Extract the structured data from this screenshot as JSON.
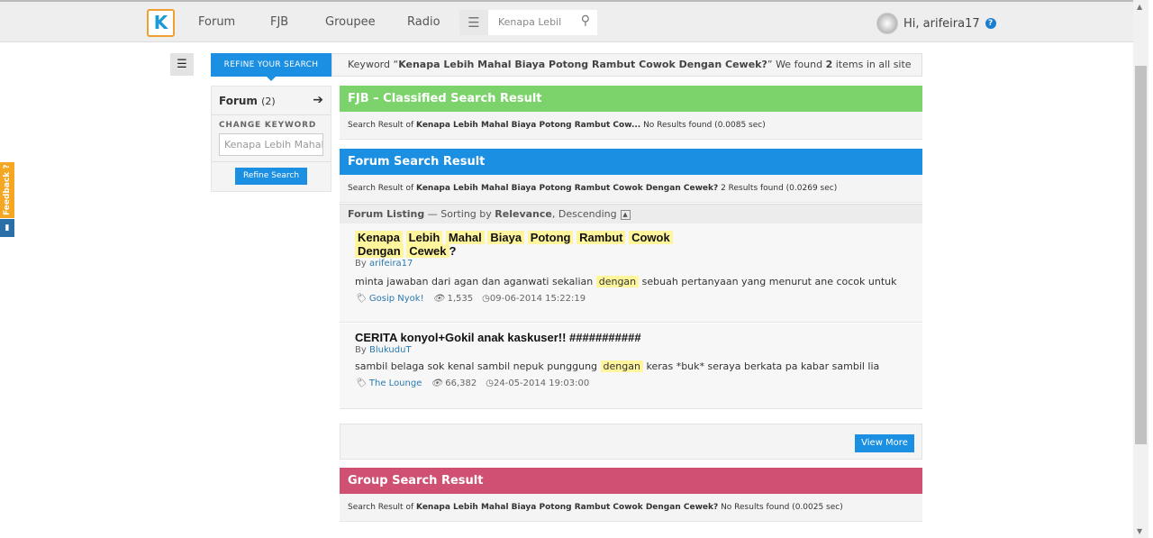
{
  "nav": {
    "logo": "K",
    "items": [
      "Forum",
      "FJB",
      "Groupee",
      "Radio"
    ],
    "search_value": "Kenapa Lebil",
    "user": "Hi, arifeira17"
  },
  "feedback": "Feedback ?",
  "refine": {
    "tab": "REFINE YOUR SEARCH",
    "forum_label": "Forum",
    "forum_count": "(2)",
    "change_keyword": "CHANGE KEYWORD",
    "keyword_value": "Kenapa Lebih Mahal",
    "button": "Refine Search"
  },
  "keyword_bar": {
    "pre": "Keyword “",
    "keyword": "Kenapa Lebih Mahal Biaya Potong Rambut Cowok Dengan Cewek?",
    "mid": "” We found ",
    "count": "2",
    "post": " items in all site"
  },
  "fjb": {
    "title": "FJB – Classified Search Result",
    "prefix": "Search Result of ",
    "keyword": "Kenapa Lebih Mahal Biaya Potong Rambut Cow...",
    "result": "  No Results found (0.0085 sec)",
    "color": "#7dd36b"
  },
  "forum": {
    "title": "Forum Search Result",
    "prefix": "Search Result of ",
    "keyword": "Kenapa Lebih Mahal Biaya Potong Rambut Cowok Dengan Cewek?",
    "result": " 2 Results found (0.0269 sec)",
    "color": "#1b8fe1",
    "listing": {
      "label": "Forum Listing",
      "mid": " — Sorting by ",
      "sort": "Relevance",
      "order": ", Descending"
    },
    "items": [
      {
        "title_words": [
          "Kenapa",
          "Lebih",
          "Mahal",
          "Biaya",
          "Potong",
          "Rambut",
          "Cowok",
          "Dengan",
          "Cewek"
        ],
        "title_end": "?",
        "by": "By ",
        "author": "arifeira17",
        "snip_pre": "minta jawaban dari agan dan aganwati sekalian ",
        "snip_hl": "dengan",
        "snip_post": " sebuah pertanyaan yang menurut ane cocok untuk",
        "category": "Gosip Nyok!",
        "views": "1,535",
        "date": "09-06-2014 15:22:19"
      },
      {
        "title": "CERITA konyol+Gokil anak kaskuser!! ###########",
        "by": "By ",
        "author": "BlukuduT",
        "snip_pre": "sambil belaga sok kenal sambil nepuk punggung ",
        "snip_hl": "dengan",
        "snip_post": " keras *buk* seraya berkata pa kabar sambil lia",
        "category": "The Lounge",
        "views": "66,382",
        "date": "24-05-2014 19:03:00"
      }
    ],
    "view_more": "View More"
  },
  "group": {
    "title": "Group Search Result",
    "prefix": "Search Result of ",
    "keyword": "Kenapa Lebih Mahal Biaya Potong Rambut Cowok Dengan Cewek?",
    "result": " No Results found (0.0025 sec)",
    "color": "#d05072"
  }
}
